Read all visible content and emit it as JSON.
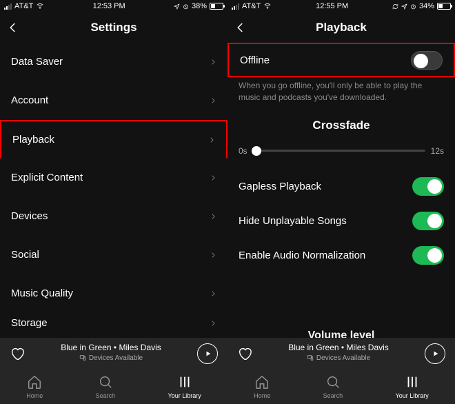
{
  "left": {
    "status": {
      "carrier": "AT&T",
      "time": "12:53 PM",
      "battery_pct": "38%"
    },
    "header": {
      "title": "Settings"
    },
    "items": [
      {
        "label": "Data Saver",
        "highlight": false
      },
      {
        "label": "Account",
        "highlight": false
      },
      {
        "label": "Playback",
        "highlight": true
      },
      {
        "label": "Explicit Content",
        "highlight": false
      },
      {
        "label": "Devices",
        "highlight": false
      },
      {
        "label": "Social",
        "highlight": false
      },
      {
        "label": "Music Quality",
        "highlight": false
      },
      {
        "label": "Storage",
        "highlight": false
      }
    ]
  },
  "right": {
    "status": {
      "carrier": "AT&T",
      "time": "12:55 PM",
      "battery_pct": "34%"
    },
    "header": {
      "title": "Playback"
    },
    "offline": {
      "label": "Offline",
      "on": false,
      "highlight": true,
      "subtext": "When you go offline, you'll only be able to play the music and podcasts you've downloaded."
    },
    "crossfade": {
      "title": "Crossfade",
      "min": "0s",
      "max": "12s"
    },
    "toggles": [
      {
        "label": "Gapless Playback",
        "on": true
      },
      {
        "label": "Hide Unplayable Songs",
        "on": true
      },
      {
        "label": "Enable Audio Normalization",
        "on": true
      }
    ],
    "next_section": "Volume level"
  },
  "nowplaying": {
    "track": "Blue in Green • Miles Davis",
    "devices": "Devices Available"
  },
  "tabs": [
    {
      "label": "Home",
      "icon": "home-icon"
    },
    {
      "label": "Search",
      "icon": "search-icon"
    },
    {
      "label": "Your Library",
      "icon": "library-icon"
    }
  ],
  "colors": {
    "accent_on": "#1db954",
    "highlight": "#ff0000"
  }
}
